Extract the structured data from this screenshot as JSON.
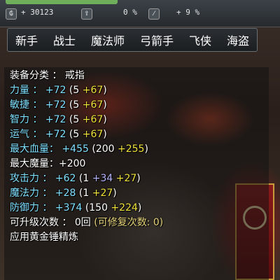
{
  "top_bar": {
    "currency_value": "+ 30123",
    "percent_1": "0 %",
    "percent_2": "+ 9 %",
    "icons": [
      "money-bag-icon",
      "upload-arrow-icon",
      "slash-box-icon"
    ]
  },
  "jobs": [
    "新手",
    "战士",
    "魔法师",
    "弓箭手",
    "飞侠",
    "海盗"
  ],
  "item": {
    "category_label": "装备分类 ：",
    "category_value": "戒指",
    "stats": [
      {
        "label": "力量 ：",
        "total": "+72",
        "open": "(5",
        "bonus": "+67",
        "close": ")"
      },
      {
        "label": "敏捷 ：",
        "total": "+72",
        "open": "(5",
        "bonus": "+67",
        "close": ")"
      },
      {
        "label": "智力 ：",
        "total": "+72",
        "open": "(5",
        "bonus": "+67",
        "close": ")"
      },
      {
        "label": "运气 ：",
        "total": "+72",
        "open": "(5",
        "bonus": "+67",
        "close": ")"
      },
      {
        "label": "最大血量：",
        "total": "+455",
        "open": "(200",
        "bonus": "+255",
        "close": ")"
      }
    ],
    "max_mp": "最大魔量：+200",
    "attack": {
      "label": "攻击力 ：",
      "total": "+62",
      "open": "(1",
      "bonus_a": "+34",
      "bonus_b": "+27",
      "close": ")"
    },
    "magic": {
      "label": "魔法力 ：",
      "total": "+28",
      "open": "(1",
      "bonus": "+27",
      "close": ")"
    },
    "defense": {
      "label": "防御力 ：",
      "total": "+374",
      "open": "(150",
      "bonus": "+224",
      "close": ")"
    },
    "upgrades_label": "可升级次数 ： 0回",
    "repairs_label": "(可修复次数: 0)",
    "hammer_label": "应用黄金锤精炼"
  },
  "colors": {
    "stat_label": "#7fe0ff",
    "bonus": "#f0e23a",
    "extra_bonus": "#b6b6ff",
    "repair_text": "#e7d57a"
  }
}
